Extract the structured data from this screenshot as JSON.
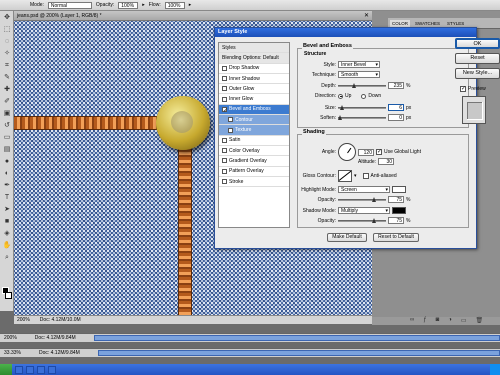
{
  "options_bar": {
    "mode_label": "Mode:",
    "mode_value": "Normal",
    "opacity_label": "Opacity:",
    "opacity_value": "100%",
    "flow_label": "Flow:",
    "flow_value": "100%"
  },
  "document": {
    "title": "jeans.psd @ 200% (Layer 1, RGB/8) *",
    "zoom": "200%",
    "doc_info": "Doc: 4.12M/10.0M"
  },
  "panel": {
    "tabs": [
      "COLOR",
      "SWATCHES",
      "STYLES"
    ]
  },
  "dialog": {
    "title": "Layer Style",
    "ok_label": "OK",
    "cancel_label": "Reset",
    "new_style_label": "New Style...",
    "preview_label": "Preview",
    "list": {
      "styles": "Styles",
      "blending": "Blending Options: Default",
      "items": [
        "Drop Shadow",
        "Inner Shadow",
        "Outer Glow",
        "Inner Glow",
        "Bevel and Emboss",
        "Contour",
        "Texture",
        "Satin",
        "Color Overlay",
        "Gradient Overlay",
        "Pattern Overlay",
        "Stroke"
      ]
    },
    "bevel": {
      "title": "Bevel and Emboss",
      "structure_label": "Structure",
      "style_label": "Style:",
      "style_value": "Inner Bevel",
      "technique_label": "Technique:",
      "technique_value": "Smooth",
      "depth_label": "Depth:",
      "depth_value": "235",
      "depth_unit": "%",
      "direction_label": "Direction:",
      "direction_up": "Up",
      "direction_down": "Down",
      "size_label": "Size:",
      "size_value": "6",
      "size_unit": "px",
      "soften_label": "Soften:",
      "soften_value": "0",
      "soften_unit": "px"
    },
    "shading": {
      "title": "Shading",
      "angle_label": "Angle:",
      "angle_value": "120",
      "global_light_label": "Use Global Light",
      "altitude_label": "Altitude:",
      "altitude_value": "30",
      "gloss_label": "Gloss Contour:",
      "anti_aliased_label": "Anti-aliased",
      "highlight_mode_label": "Highlight Mode:",
      "highlight_mode_value": "Screen",
      "highlight_color": "#ffffff",
      "hl_opacity_label": "Opacity:",
      "hl_opacity_value": "75",
      "shadow_mode_label": "Shadow Mode:",
      "shadow_mode_value": "Multiply",
      "shadow_color": "#000000",
      "sh_opacity_label": "Opacity:",
      "sh_opacity_value": "75",
      "percent_unit": "%"
    },
    "make_default_label": "Make Default",
    "reset_default_label": "Reset to Default"
  },
  "lower_status_1": {
    "zoom": "200%",
    "doc_info": "Doc: 4.12M/9.84M"
  },
  "lower_status_2": {
    "zoom": "33.33%",
    "doc_info": "Doc: 4.12M/9.84M"
  }
}
